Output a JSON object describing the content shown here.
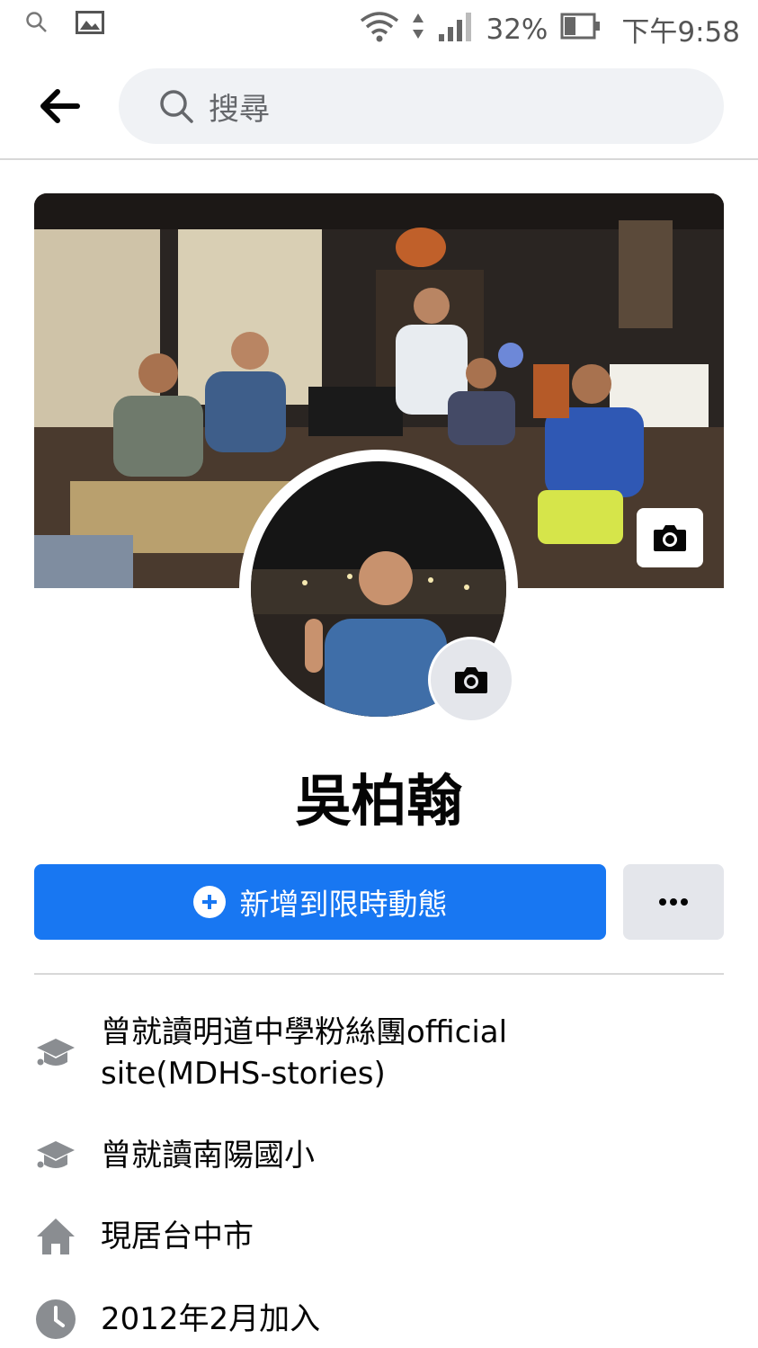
{
  "status_bar": {
    "battery": "32%",
    "time": "下午9:58"
  },
  "search": {
    "placeholder": "搜尋"
  },
  "profile": {
    "name": "吳柏翰"
  },
  "actions": {
    "add_story_label": "新增到限時動態",
    "more_label": "..."
  },
  "intro": [
    {
      "icon": "graduation-cap-icon",
      "text": "曾就讀明道中學粉絲團official site(MDHS-stories)"
    },
    {
      "icon": "graduation-cap-icon",
      "text": "曾就讀南陽國小"
    },
    {
      "icon": "home-icon",
      "text": "現居台中市"
    },
    {
      "icon": "clock-icon",
      "text": "2012年2月加入"
    }
  ],
  "colors": {
    "primary": "#1877f2",
    "icon_gray": "#8a8d91",
    "secondary_button": "#e4e6eb"
  }
}
